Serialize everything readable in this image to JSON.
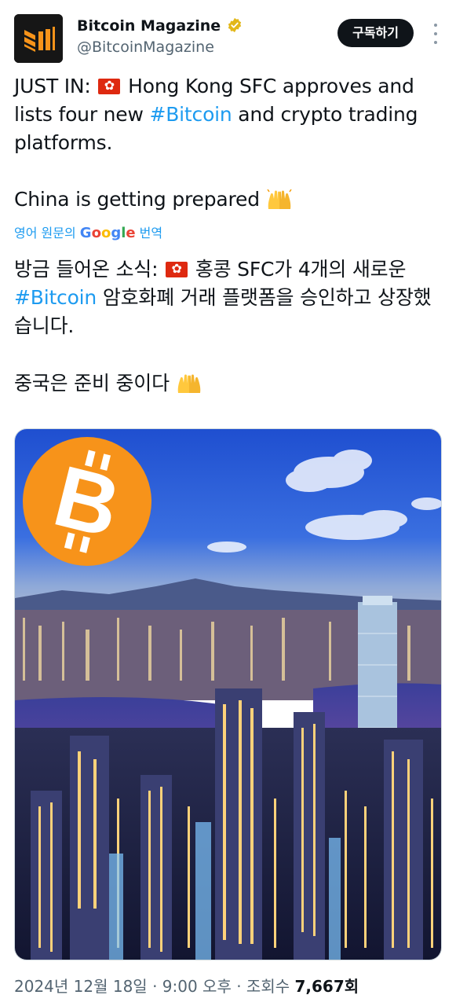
{
  "author": {
    "display_name": "Bitcoin Magazine",
    "handle": "@BitcoinMagazine",
    "verified_icon": "verified-badge-gold"
  },
  "actions": {
    "subscribe_label": "구독하기",
    "more_icon": "more-vertical-icon"
  },
  "original_text": {
    "line1_prefix": "JUST IN: ",
    "line1_rest": " Hong Kong SFC approves and lists four new ",
    "hashtag": "#Bitcoin",
    "line1_suffix": " and crypto trading platforms.",
    "line2": "China is getting prepared "
  },
  "translate": {
    "prefix": "영어 원문의 ",
    "google_G": "G",
    "google_o1": "o",
    "google_o2": "o",
    "google_g": "g",
    "google_l": "l",
    "google_e": "e",
    "suffix": " 번역"
  },
  "translated_text": {
    "line1_prefix": "방금 들어온 소식: ",
    "line1_rest": " 홍콩 SFC가 4개의 새로운 ",
    "hashtag": "#Bitcoin",
    "line1_suffix": " 암호화폐 거래 플랫폼을 승인하고 상장했습니다.",
    "line2": "중국은 준비 중이다 "
  },
  "media": {
    "icon": "bitcoin-logo"
  },
  "meta": {
    "date_time": "2024년 12월 18일 · 9:00 오후 · 조회수 ",
    "views": "7,667회"
  },
  "colors": {
    "accent": "#1d9bf0",
    "bitcoin_orange": "#f7931a",
    "verified_gold": "#e2b719"
  }
}
